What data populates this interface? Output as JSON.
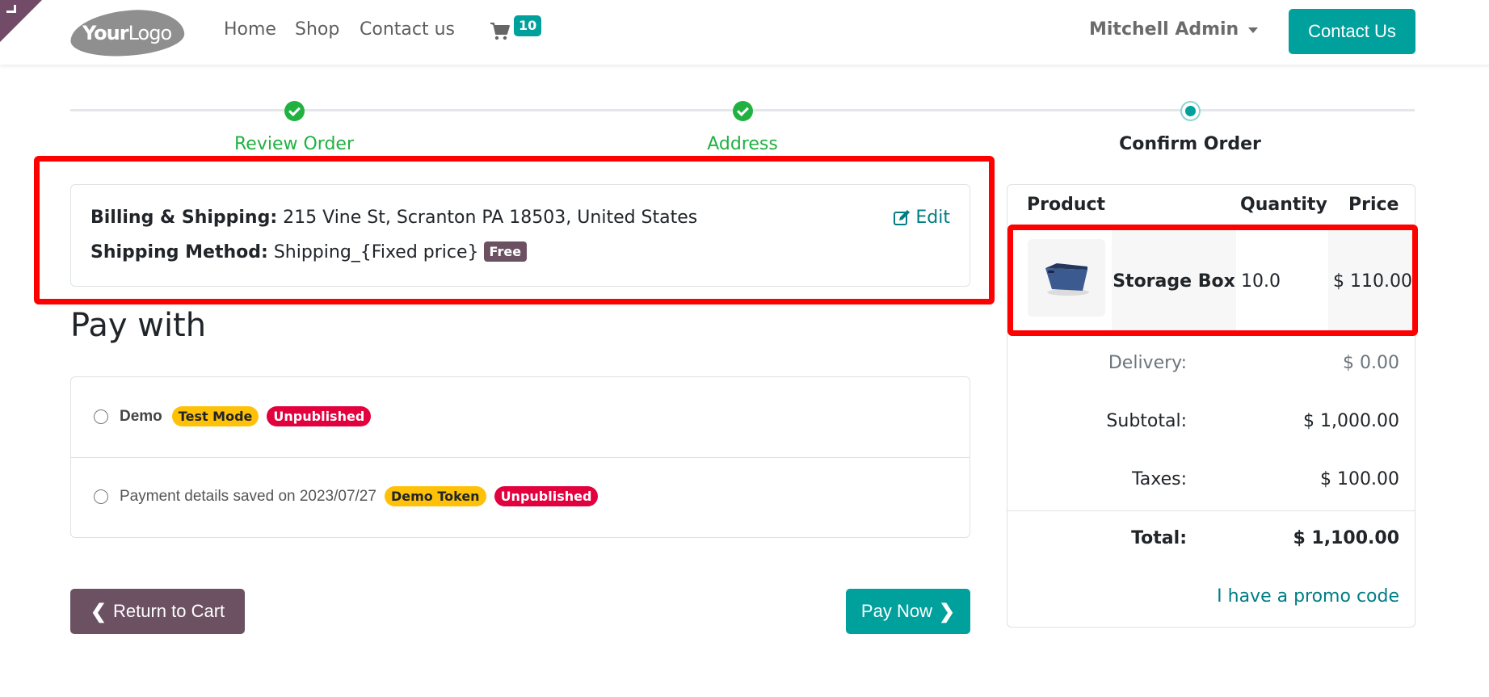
{
  "header": {
    "logo_text_bold": "Your",
    "logo_text_light": "Logo",
    "nav": [
      "Home",
      "Shop",
      "Contact us"
    ],
    "cart_icon": "shopping-cart-icon",
    "cart_count": "10",
    "user_name": "Mitchell Admin",
    "contact_button": "Contact Us"
  },
  "progress": {
    "steps": [
      {
        "label": "Review Order",
        "status": "done"
      },
      {
        "label": "Address",
        "status": "done"
      },
      {
        "label": "Confirm Order",
        "status": "current"
      }
    ]
  },
  "address": {
    "billing_label": "Billing & Shipping:",
    "billing_value": "215 Vine St, Scranton PA 18503, United States",
    "shipping_label": "Shipping Method:",
    "shipping_value": "Shipping_{Fixed price}",
    "shipping_badge": "Free",
    "edit_label": "Edit",
    "edit_icon": "edit-icon"
  },
  "payment": {
    "title": "Pay with",
    "options": [
      {
        "name": "Demo",
        "badges": [
          "Test Mode",
          "Unpublished"
        ]
      },
      {
        "text": "Payment details saved on 2023/07/27",
        "badges": [
          "Demo Token",
          "Unpublished"
        ]
      }
    ]
  },
  "actions": {
    "return_label": "Return to Cart",
    "pay_label": "Pay Now"
  },
  "summary": {
    "headers": {
      "product": "Product",
      "quantity": "Quantity",
      "price": "Price"
    },
    "items": [
      {
        "name": "Storage Box",
        "quantity": "10.0",
        "price": "$ 110.00"
      }
    ],
    "delivery_label": "Delivery:",
    "delivery_value": "$ 0.00",
    "subtotal_label": "Subtotal:",
    "subtotal_value": "$ 1,000.00",
    "taxes_label": "Taxes:",
    "taxes_value": "$ 100.00",
    "total_label": "Total:",
    "total_value": "$ 1,100.00",
    "promo_label": "I have a promo code"
  },
  "colors": {
    "primary": "#00A09D",
    "secondary": "#6c5163",
    "success": "#21b141",
    "warning": "#ffc107",
    "danger": "#e3003f",
    "highlight": "#ff0000"
  }
}
